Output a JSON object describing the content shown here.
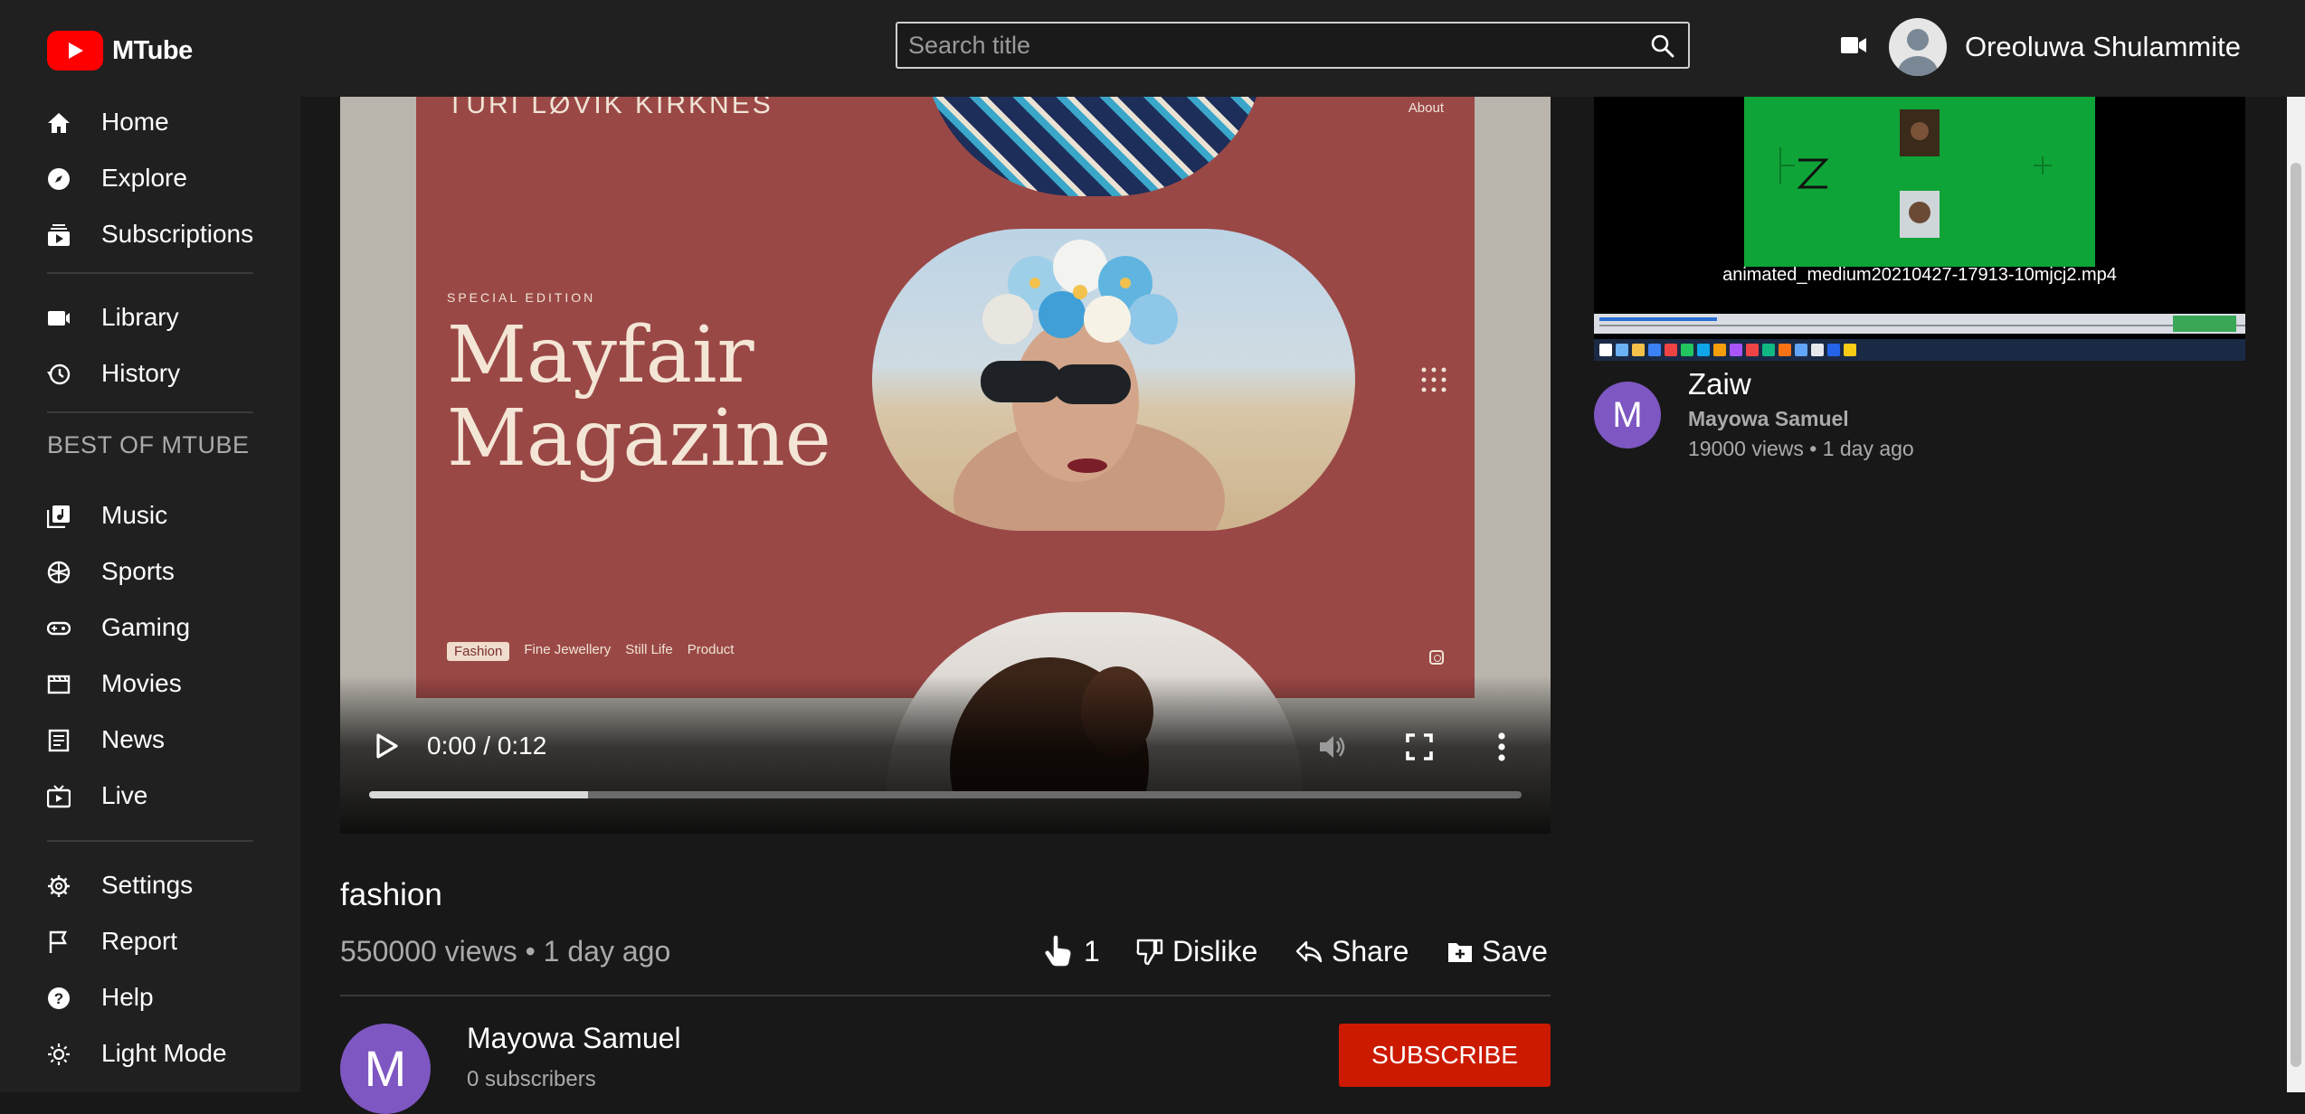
{
  "app": {
    "name": "MTube"
  },
  "header": {
    "search_placeholder": "Search title",
    "user_name": "Oreoluwa Shulammite"
  },
  "sidebar": {
    "primary": [
      {
        "label": "Home",
        "icon": "home-icon"
      },
      {
        "label": "Explore",
        "icon": "compass-icon"
      },
      {
        "label": "Subscriptions",
        "icon": "subscriptions-icon"
      }
    ],
    "library": [
      {
        "label": "Library",
        "icon": "library-icon"
      },
      {
        "label": "History",
        "icon": "history-icon"
      }
    ],
    "section_title": "BEST OF MTUBE",
    "best": [
      {
        "label": "Music",
        "icon": "music-icon"
      },
      {
        "label": "Sports",
        "icon": "sports-icon"
      },
      {
        "label": "Gaming",
        "icon": "gaming-icon"
      },
      {
        "label": "Movies",
        "icon": "movies-icon"
      },
      {
        "label": "News",
        "icon": "news-icon"
      },
      {
        "label": "Live",
        "icon": "live-icon"
      }
    ],
    "bottom": [
      {
        "label": "Settings",
        "icon": "gear-icon"
      },
      {
        "label": "Report",
        "icon": "flag-icon"
      },
      {
        "label": "Help",
        "icon": "help-icon"
      },
      {
        "label": "Light Mode",
        "icon": "sun-icon"
      }
    ]
  },
  "player": {
    "time": "0:00 / 0:12",
    "progress_fraction": 0.19,
    "frame": {
      "brand": "TURI LØVIK KIRKNES",
      "about": "About",
      "special": "SPECIAL EDITION",
      "title_line1": "Mayfair",
      "title_line2": "Magazine",
      "nav": [
        "Fashion",
        "Fine Jewellery",
        "Still Life",
        "Product"
      ]
    }
  },
  "video": {
    "title": "fashion",
    "meta": "550000 views • 1 day ago",
    "likes": "1",
    "dislike_label": "Dislike",
    "share_label": "Share",
    "save_label": "Save"
  },
  "channel": {
    "initial": "M",
    "name": "Mayowa Samuel",
    "subscribers": "0 subscribers",
    "subscribe_label": "SUBSCRIBE"
  },
  "recommended": [
    {
      "thumb_caption": "animated_medium20210427-17913-10mjcj2.mp4",
      "initial": "M",
      "title": "Zaiw",
      "channel": "Mayowa Samuel",
      "meta": "19000 views • 1 day ago"
    }
  ],
  "colors": {
    "brand_red": "#ff0000",
    "subscribe_red": "#cc1a00",
    "avatar_purple": "#7e57c2",
    "background": "#181818",
    "sidebar": "#202020"
  }
}
